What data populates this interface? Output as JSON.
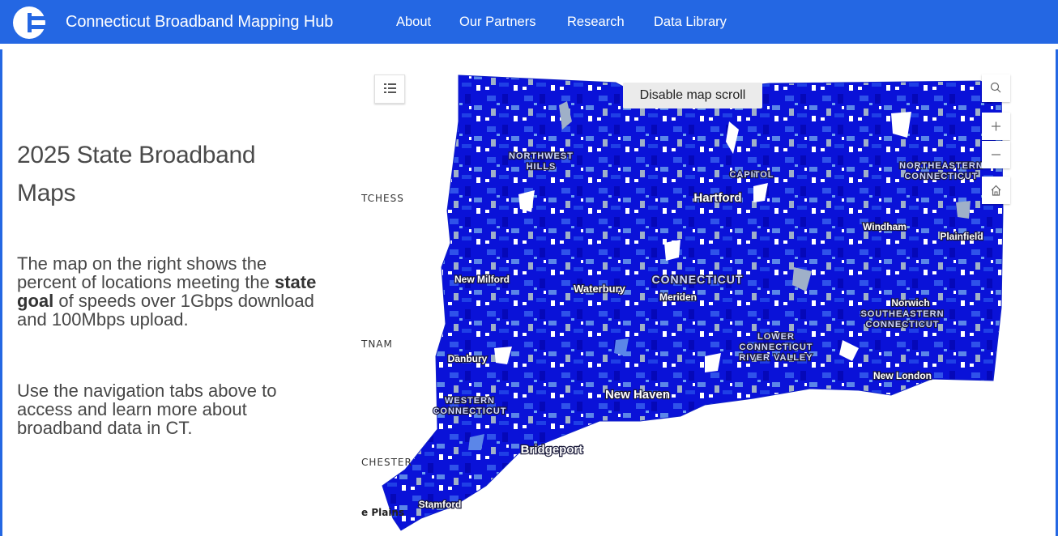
{
  "header": {
    "brand": "Connecticut Broadband Mapping Hub",
    "nav": [
      "About",
      "Our Partners",
      "Research",
      "Data Library"
    ],
    "colors": {
      "bar": "#2467e3",
      "text": "#ffffff"
    },
    "logo_icon": "ct-logo-icon"
  },
  "sidebar": {
    "title": "2025 State Broadband Maps",
    "para1_before": "The map on the right shows the percent of locations meeting the ",
    "para1_bold": "state goal",
    "para1_after": " of speeds over 1Gbps download and 100Mbps upload.",
    "para2": "Use the navigation tabs above to access and learn more about broadband data in CT."
  },
  "map": {
    "tooltip": "Disable map scroll",
    "controls": {
      "legend": "legend-list-icon",
      "search": "search-icon",
      "zoom_in": "+",
      "zoom_out": "−",
      "home": "home-icon"
    },
    "edge_labels": [
      "TCHESS",
      "TNAM",
      "CHESTER",
      "e Plains"
    ],
    "places": [
      "NORTHWEST",
      "HILLS",
      "CAPITOL",
      "Hartford",
      "NORTHEASTERN",
      "CONNECTICUT",
      "Windham",
      "Plainfield",
      "New Milford",
      "Waterbury",
      "CONNECTICUT",
      "Meriden",
      "Norwich",
      "SOUTHEASTERN",
      "CONNECTICUT",
      "LOWER",
      "CONNECTICUT",
      "RIVER VALLEY",
      "Danbury",
      "New London",
      "New Haven",
      "WESTERN",
      "CONNECTICUT",
      "Bridgeport",
      "Stamford"
    ],
    "colors": {
      "fill_dark": "#0a10d8",
      "fill_mid": "#1f3fe6",
      "fill_light": "#5b86e8",
      "gap": "#9fb0c8"
    }
  }
}
